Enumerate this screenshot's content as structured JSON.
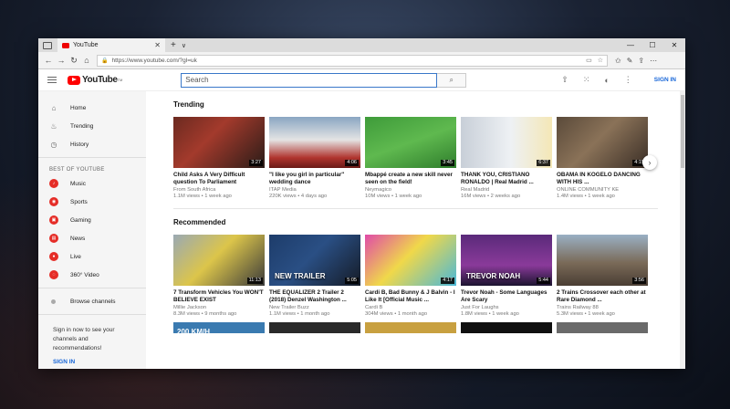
{
  "browser": {
    "tab_title": "YouTube",
    "tab_close": "✕",
    "new_tab": "+",
    "tab_dropdown": "∨",
    "win_min": "—",
    "win_max": "☐",
    "win_close": "✕",
    "url": "https://www.youtube.com/?gl=uk"
  },
  "header": {
    "logo_text": "YouTube",
    "logo_sup": "TM",
    "search_placeholder": "Search",
    "signin": "SIGN IN"
  },
  "sidebar": {
    "nav": [
      {
        "label": "Home",
        "icon": "⌂"
      },
      {
        "label": "Trending",
        "icon": "♨"
      },
      {
        "label": "History",
        "icon": "◷"
      }
    ],
    "best_title": "BEST OF YOUTUBE",
    "best": [
      {
        "label": "Music",
        "icon": "♪"
      },
      {
        "label": "Sports",
        "icon": "◉"
      },
      {
        "label": "Gaming",
        "icon": "▣"
      },
      {
        "label": "News",
        "icon": "▤"
      },
      {
        "label": "Live",
        "icon": "●"
      },
      {
        "label": "360° Video",
        "icon": "◌"
      }
    ],
    "browse_channels": "Browse channels",
    "signin_message": "Sign in now to see your channels and recommendations!",
    "signin": "SIGN IN"
  },
  "trending": {
    "title": "Trending",
    "videos": [
      {
        "title": "Child Asks A Very Difficult question To Parliament",
        "channel": "From South Africa",
        "meta": "1.1M views • 1 week ago",
        "duration": "3:27",
        "bg": "linear-gradient(135deg,#6b2a20 0%,#a33a2c 40%,#2a1c18 100%)"
      },
      {
        "title": "\"I like you girl in particular\" wedding dance",
        "channel": "ITAP Media",
        "meta": "220K views • 4 days ago",
        "duration": "4:06",
        "bg": "linear-gradient(180deg,#8aa6c2 0%,#e4e4e4 45%,#b0342e 80%,#6a1a16 100%)"
      },
      {
        "title": "Mbappé create a new skill never seen on the field!",
        "channel": "Neymagico",
        "meta": "10M views • 1 week ago",
        "duration": "3:45",
        "bg": "linear-gradient(160deg,#3e9b3a 0%,#5fb94f 50%,#2f7d2c 100%)"
      },
      {
        "title": "THANK YOU, CRISTIANO RONALDO | Real Madrid ...",
        "channel": "Real Madrid",
        "meta": "16M views • 2 weeks ago",
        "duration": "6:37",
        "bg": "linear-gradient(90deg,#c8cfd8 0%,#eef1f4 55%,#f4e7b6 100%)"
      },
      {
        "title": "OBAMA IN KOGELO DANCING WITH HIS ...",
        "channel": "ONLINE COMMUNITY KE",
        "meta": "1.4M views • 1 week ago",
        "duration": "4:15",
        "bg": "linear-gradient(135deg,#5a4a3a 0%,#8a7258 45%,#3a2e26 100%)"
      }
    ]
  },
  "recommended": {
    "title": "Recommended",
    "videos": [
      {
        "title": "7 Transform Vehicles You WON'T BELIEVE EXIST",
        "channel": "Millie Jackson",
        "meta": "8.3M views • 9 months ago",
        "duration": "11:13",
        "bg": "linear-gradient(135deg,#9aa9b4 0%,#dcc54a 45%,#3b3b3b 100%)"
      },
      {
        "title": "THE EQUALIZER 2 Trailer 2 (2018) Denzel Washington ...",
        "channel": "New Trailer Buzz",
        "meta": "1.1M views • 1 month ago",
        "duration": "5:05",
        "bg": "linear-gradient(135deg,#1d3c6a 0%,#2a4f84 45%,#151b26 100%)"
      },
      {
        "title": "Cardi B, Bad Bunny & J Balvin - I Like It [Official Music ...",
        "channel": "Cardi B",
        "meta": "304M views • 1 month ago",
        "duration": "4:17",
        "bg": "linear-gradient(135deg,#e04ba8 0%,#f0d84a 45%,#4ab8d8 100%)"
      },
      {
        "title": "Trevor Noah - Some Languages Are Scary",
        "channel": "Just For Laughs",
        "meta": "1.8M views • 1 week ago",
        "duration": "5:44",
        "bg": "linear-gradient(180deg,#5a2a7a 0%,#8a3a9a 60%,#1c1430 100%)"
      },
      {
        "title": "2 Trains Crossover each other at Rare Diamond ...",
        "channel": "Trains Railway 88",
        "meta": "5.3M views • 1 week ago",
        "duration": "3:56",
        "bg": "linear-gradient(180deg,#9ab0c4 0%,#7a6a58 55%,#4a3e34 100%)"
      }
    ],
    "overlays": [
      "",
      "NEW TRAILER",
      "",
      "TREVOR NOAH",
      ""
    ]
  },
  "peek_row": {
    "first_label": "200 KM/H",
    "colors": [
      "#3a7ab0",
      "#2a2a2a",
      "#c8a040",
      "#101010",
      "#6a6a6a"
    ]
  },
  "colors": {
    "brand_red": "#ff0000",
    "link_blue": "#1665d8"
  }
}
